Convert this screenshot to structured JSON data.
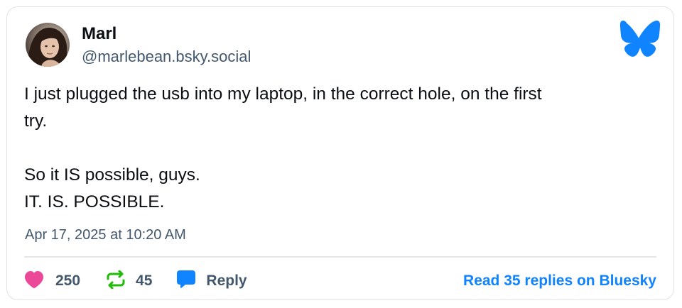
{
  "author": {
    "display_name": "Marl",
    "handle": "@marlebean.bsky.social"
  },
  "post": {
    "lines": [
      "I just plugged the usb into my laptop, in the correct hole, on the first",
      "try.",
      "",
      "So it IS possible, guys.",
      "IT. IS. POSSIBLE."
    ],
    "timestamp": "Apr 17, 2025 at 10:20 AM"
  },
  "actions": {
    "likes": "250",
    "reposts": "45",
    "reply_label": "Reply",
    "read_replies_label": "Read 35 replies on Bluesky"
  },
  "icons": {
    "logo": "bluesky-butterfly-icon",
    "like": "heart-icon",
    "repost": "repost-icon",
    "reply": "speech-bubble-icon"
  },
  "colors": {
    "brand_blue": "#1083fe",
    "like_pink": "#ec4899",
    "repost_green": "#20bc07",
    "muted_text": "#42576c",
    "primary_text": "#0b0f14"
  }
}
